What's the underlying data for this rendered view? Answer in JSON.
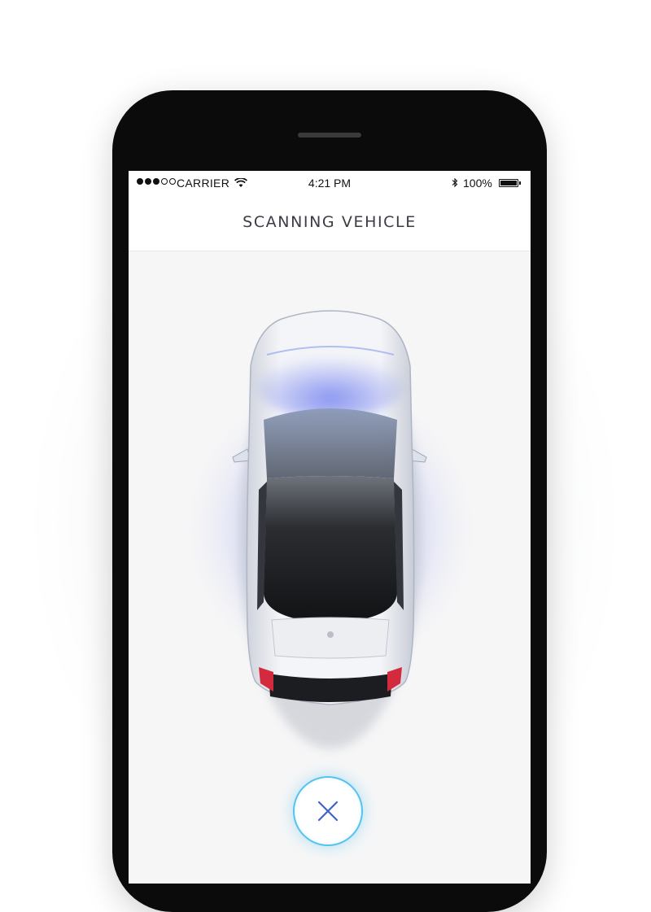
{
  "status_bar": {
    "carrier": "CARRIER",
    "time": "4:21 PM",
    "battery": "100%",
    "signal_bars": 3,
    "signal_total": 5
  },
  "header": {
    "title": "SCANNING VEHICLE"
  },
  "colors": {
    "accent": "#55c3ee",
    "scan_glow": "#7f8cf0",
    "background": "#f6f6f7",
    "title_text": "#3a3d45"
  },
  "icons": {
    "cancel": "close-icon",
    "wifi": "wifi-icon",
    "bluetooth": "bluetooth-icon",
    "battery": "battery-icon"
  }
}
